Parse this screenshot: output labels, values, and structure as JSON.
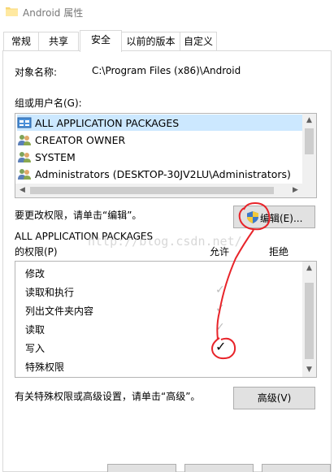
{
  "window": {
    "title": "Android 属性"
  },
  "tabs": [
    {
      "label": "常规"
    },
    {
      "label": "共享"
    },
    {
      "label": "安全"
    },
    {
      "label": "以前的版本"
    },
    {
      "label": "自定义"
    }
  ],
  "security": {
    "object_name_label": "对象名称:",
    "object_name_value": "C:\\Program Files (x86)\\Android",
    "group_label": "组或用户名(G):",
    "users": [
      {
        "name": "ALL APPLICATION PACKAGES",
        "icon": "app-packages-icon"
      },
      {
        "name": "CREATOR OWNER",
        "icon": "users-icon"
      },
      {
        "name": "SYSTEM",
        "icon": "users-icon"
      },
      {
        "name": "Administrators (DESKTOP-30JV2LU\\Administrators)",
        "icon": "users-icon"
      }
    ],
    "edit_hint": "要更改权限，请单击“编辑”。",
    "edit_button": "编辑(E)...",
    "perm_for_name": "ALL APPLICATION PACKAGES",
    "perm_for_label": "的权限(P)",
    "allow_header": "允许",
    "deny_header": "拒绝",
    "permissions": [
      {
        "name": "修改",
        "allow": ""
      },
      {
        "name": "读取和执行",
        "allow": "✓"
      },
      {
        "name": "列出文件夹内容",
        "allow": "✓"
      },
      {
        "name": "读取",
        "allow": "✓"
      },
      {
        "name": "写入",
        "allow": "✓"
      },
      {
        "name": "特殊权限",
        "allow": ""
      }
    ],
    "advanced_hint": "有关特殊权限或高级设置，请单击“高级”。",
    "advanced_button": "高级(V)"
  },
  "watermark": "http://blog.csdn.net/",
  "annotation_color": "#e8242a"
}
